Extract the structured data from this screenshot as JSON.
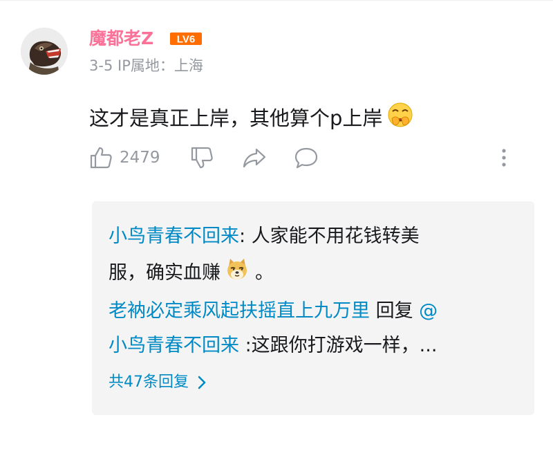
{
  "comment": {
    "username": "魔都老Z",
    "level_badge": "LV6",
    "date": "3-5",
    "ip_location": "IP属地：上海",
    "text": "这才是真正上岸，其他算个p上岸",
    "emoji": "laughing-cover-mouth-emoji",
    "like_count": "2479"
  },
  "replies": [
    {
      "author": "小鸟青春不回来",
      "separator": ": ",
      "text_line1": "人家能不用花钱转美",
      "text_line2_before": "服，确实血赚",
      "emoji": "doge-emoji",
      "text_line2_after": "。"
    },
    {
      "author": "老衲必定乘风起扶摇直上九万里",
      "reply_word": " 回复 ",
      "mention": "@",
      "mention_name": "小鸟青春不回来",
      "text": " :这跟你打游戏一样，..."
    }
  ],
  "more_replies_label": "共47条回复",
  "colors": {
    "username": "#fb7299",
    "link": "#008ac5",
    "meta": "#9499a0",
    "reply_bg": "#f4f4f4"
  },
  "icons": [
    "thumbs-up-icon",
    "thumbs-down-icon",
    "share-icon",
    "reply-bubble-icon",
    "more-vertical-icon",
    "chevron-right-icon"
  ]
}
